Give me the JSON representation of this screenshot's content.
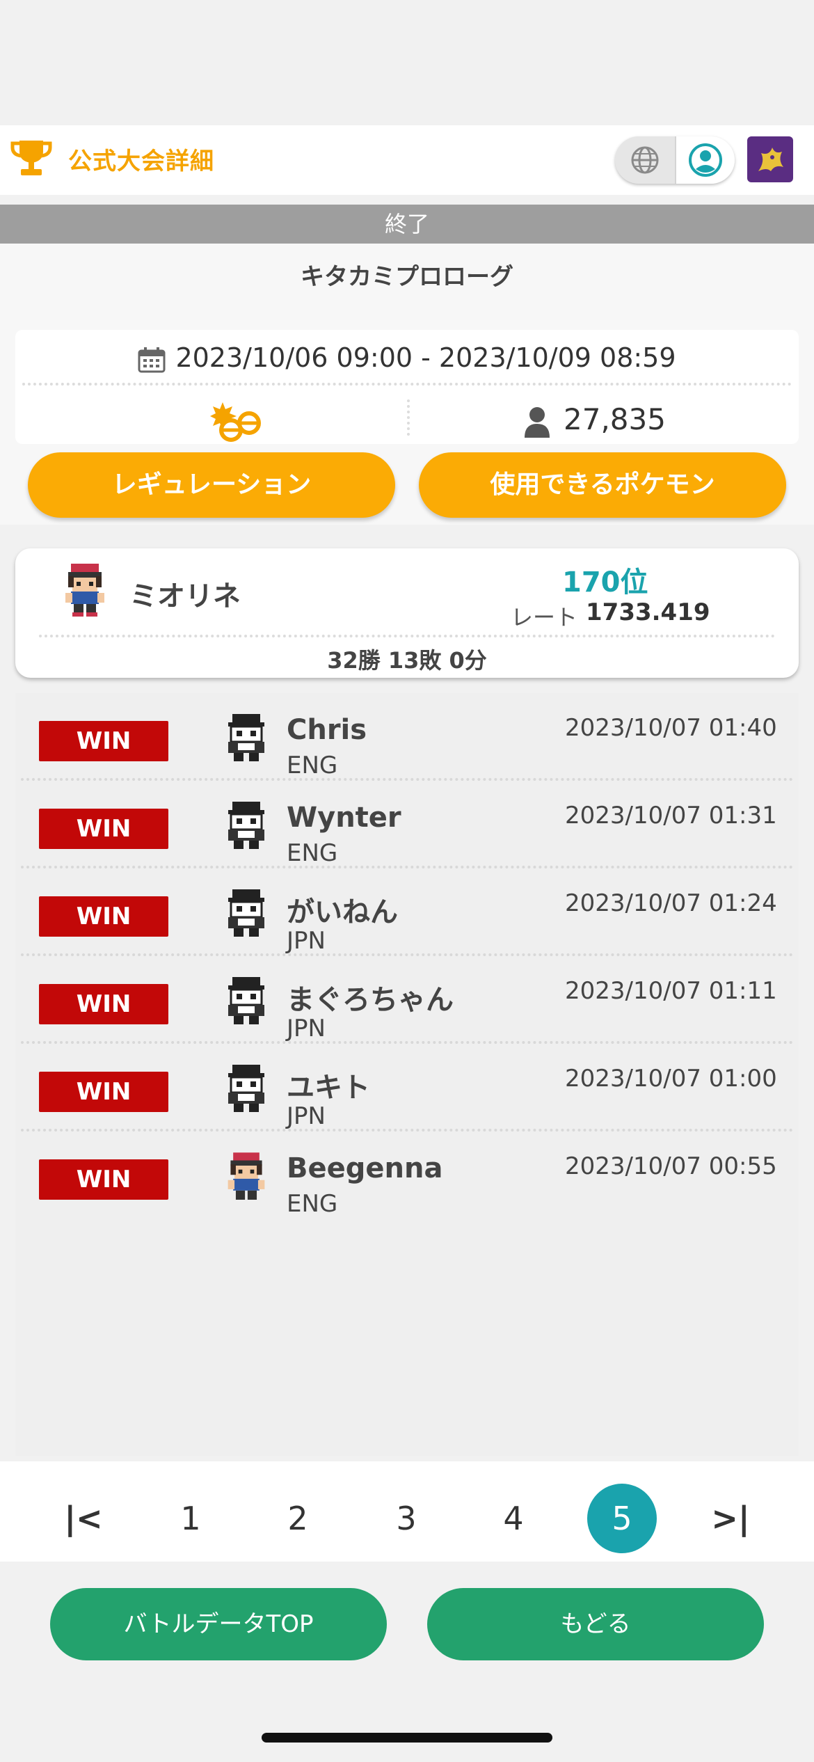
{
  "header": {
    "title": "公式大会詳細",
    "accent_color": "#f5a300",
    "icons": [
      "trophy-icon",
      "globe-icon",
      "profile-icon",
      "dragon-emblem"
    ]
  },
  "competition": {
    "status": "終了",
    "name": "キタカミプロローグ",
    "period": "2023/10/06 09:00 - 2023/10/09 08:59",
    "format_icon": "double-battle-icon",
    "participants": "27,835"
  },
  "buttons": {
    "regulation": "レギュレーション",
    "usable_pokemon": "使用できるポケモン",
    "battle_data_top": "バトルデータTOP",
    "back": "もどる"
  },
  "player": {
    "name": "ミオリネ",
    "rank": "170位",
    "rate_label": "レート",
    "rate_value": "1733.419",
    "record": "32勝 13敗 0分"
  },
  "matches": [
    {
      "result": "WIN",
      "opponent": "Chris",
      "lang": "ENG",
      "time": "2023/10/07 01:40",
      "sprite": "gray"
    },
    {
      "result": "WIN",
      "opponent": "Wynter",
      "lang": "ENG",
      "time": "2023/10/07 01:31",
      "sprite": "gray"
    },
    {
      "result": "WIN",
      "opponent": "がいねん",
      "lang": "JPN",
      "time": "2023/10/07 01:24",
      "sprite": "gray"
    },
    {
      "result": "WIN",
      "opponent": "まぐろちゃん",
      "lang": "JPN",
      "time": "2023/10/07 01:11",
      "sprite": "gray"
    },
    {
      "result": "WIN",
      "opponent": "ユキト",
      "lang": "JPN",
      "time": "2023/10/07 01:00",
      "sprite": "gray"
    },
    {
      "result": "WIN",
      "opponent": "Beegenna",
      "lang": "ENG",
      "time": "2023/10/07 00:55",
      "sprite": "color"
    }
  ],
  "pagination": {
    "first": "|<",
    "last": ">|",
    "pages": [
      "1",
      "2",
      "3",
      "4",
      "5"
    ],
    "current": "5"
  },
  "colors": {
    "win": "#c20808",
    "orange_button": "#fbab05",
    "green_button": "#23a26d",
    "teal": "#1aa3ad"
  }
}
